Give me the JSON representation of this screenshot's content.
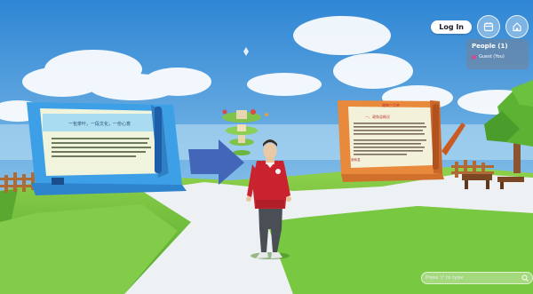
{
  "header": {
    "login_label": "Log In",
    "calendar_icon": "calendar-icon",
    "home_icon": "home-icon"
  },
  "people_panel": {
    "title": "People (1)",
    "entries": [
      {
        "name": "Guest (You)",
        "dot_color": "#d44a8a"
      }
    ]
  },
  "chat": {
    "placeholder": "Press '/' to type",
    "send_icon": "search-icon"
  },
  "left_board": {
    "heading": "一包茶叶，一段文化，一份心意"
  },
  "right_board": {
    "logo_text": "政和三月茶",
    "heading": "一、政和县概况",
    "footer": "政和县"
  }
}
